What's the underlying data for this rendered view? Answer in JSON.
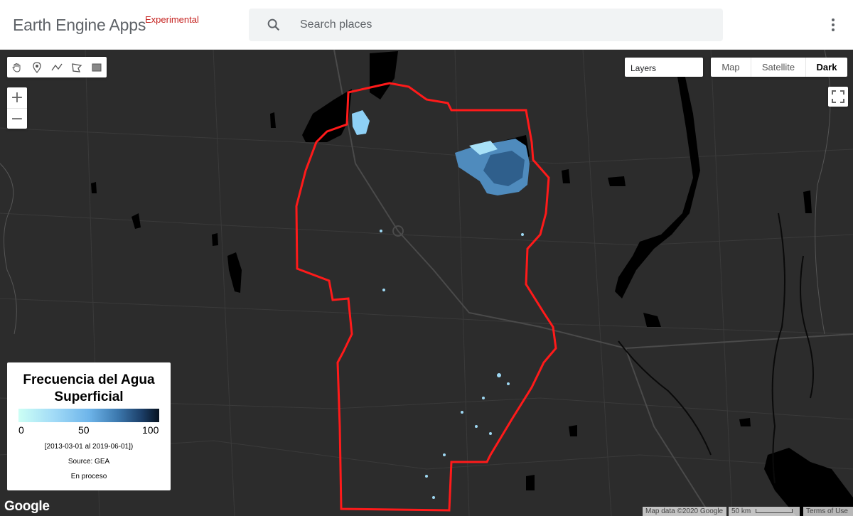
{
  "header": {
    "app_title": "Earth Engine Apps",
    "badge": "Experimental",
    "search_placeholder": "Search places",
    "menu_icon": "more-vert-icon"
  },
  "map": {
    "drawing_tools": [
      {
        "name": "hand-pan-icon"
      },
      {
        "name": "point-marker-icon"
      },
      {
        "name": "line-tool-icon"
      },
      {
        "name": "polygon-tool-icon"
      },
      {
        "name": "rectangle-tool-icon"
      }
    ],
    "zoom_in": "+",
    "zoom_out": "−",
    "layers_label": "Layers",
    "map_types": {
      "map": "Map",
      "satellite": "Satellite",
      "dark": "Dark"
    },
    "selected_map_type": "Dark",
    "fullscreen_icon": "fullscreen-icon",
    "boundary_color": "#ff0000",
    "water_color": "#000000"
  },
  "legend": {
    "title_line1": "Frecuencia del Agua",
    "title_line2": "Superficial",
    "tick_min": "0",
    "tick_mid": "50",
    "tick_max": "100",
    "date_range": "[2013-03-01 al 2019-06-01])",
    "source": "Source: GEA",
    "status": "En proceso",
    "gradient_start": "#ccfff5",
    "gradient_end": "#06121f"
  },
  "footer": {
    "google_logo": "Google",
    "map_data": "Map data ©2020 Google",
    "scale": "50 km",
    "terms": "Terms of Use"
  }
}
